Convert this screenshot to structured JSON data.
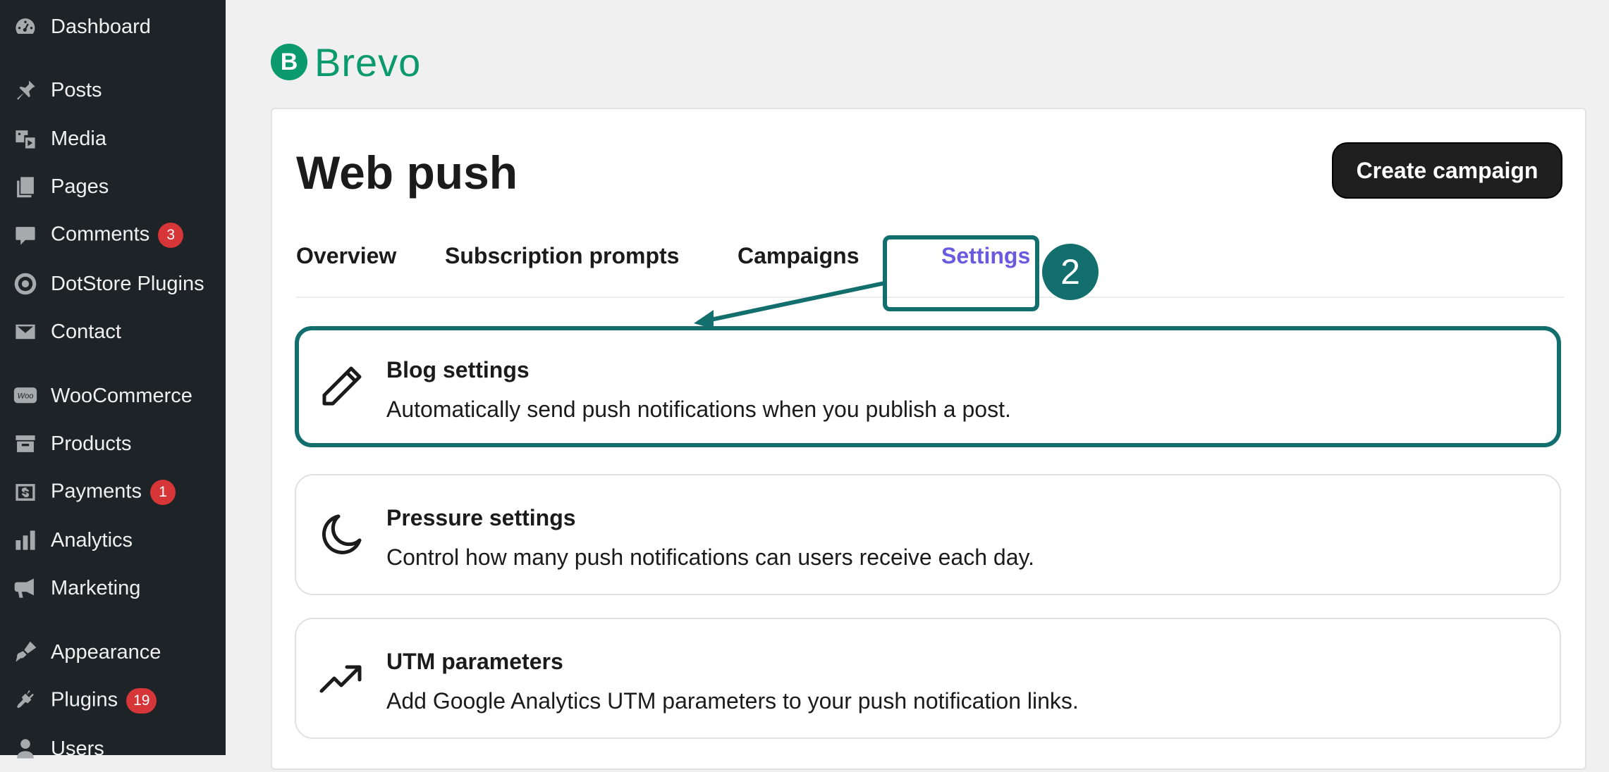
{
  "sidebar": {
    "items": [
      {
        "label": "Dashboard",
        "icon": "dashboard-icon"
      },
      {
        "label": "Posts",
        "icon": "pin-icon"
      },
      {
        "label": "Media",
        "icon": "media-icon"
      },
      {
        "label": "Pages",
        "icon": "pages-icon"
      },
      {
        "label": "Comments",
        "icon": "comment-icon",
        "badge": "3"
      },
      {
        "label": "DotStore Plugins",
        "icon": "target-icon"
      },
      {
        "label": "Contact",
        "icon": "mail-icon"
      },
      {
        "label": "WooCommerce",
        "icon": "woo-icon",
        "icon_text": "Woo"
      },
      {
        "label": "Products",
        "icon": "archive-icon"
      },
      {
        "label": "Payments",
        "icon": "dollar-icon",
        "badge": "1"
      },
      {
        "label": "Analytics",
        "icon": "bar-chart-icon"
      },
      {
        "label": "Marketing",
        "icon": "megaphone-icon"
      },
      {
        "label": "Appearance",
        "icon": "brush-icon"
      },
      {
        "label": "Plugins",
        "icon": "plug-icon",
        "badge": "19"
      },
      {
        "label": "Users",
        "icon": "user-icon"
      }
    ]
  },
  "brand": {
    "mark": "B",
    "name": "Brevo",
    "color": "#0b996e"
  },
  "page": {
    "title": "Web push",
    "create_button": "Create campaign"
  },
  "tabs": [
    {
      "label": "Overview",
      "active": false
    },
    {
      "label": "Subscription prompts",
      "active": false
    },
    {
      "label": "Campaigns",
      "active": false
    },
    {
      "label": "Settings",
      "active": true
    }
  ],
  "annotation": {
    "step": "2",
    "color": "#136e6e"
  },
  "cards": [
    {
      "title": "Blog settings",
      "description": "Automatically send push notifications when you publish a post.",
      "icon": "pencil-icon",
      "highlighted": true
    },
    {
      "title": "Pressure settings",
      "description": "Control how many push notifications can users receive each day.",
      "icon": "moon-icon",
      "highlighted": false
    },
    {
      "title": "UTM parameters",
      "description": "Add Google Analytics UTM parameters to your push notification links.",
      "icon": "trend-up-icon",
      "highlighted": false
    }
  ],
  "colors": {
    "sidebar_bg": "#1d2327",
    "accent_tab": "#6a5ae0",
    "badge": "#d63638"
  }
}
